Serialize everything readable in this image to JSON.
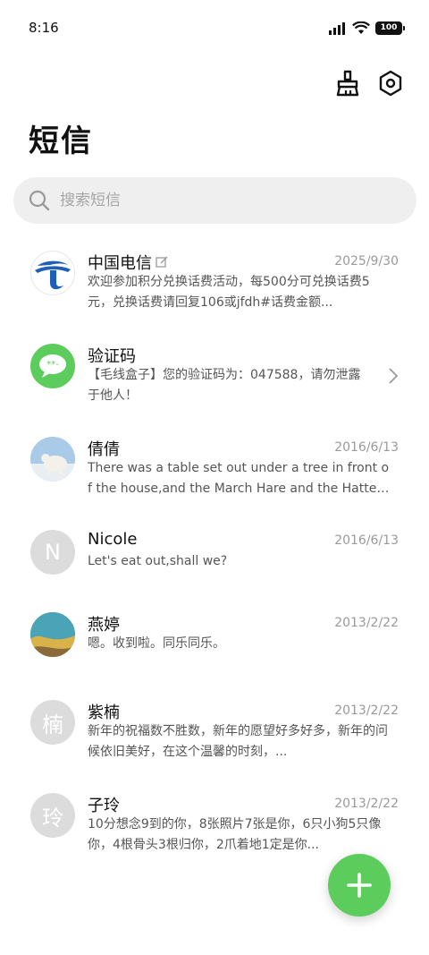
{
  "status": {
    "time": "8:16",
    "battery": "100"
  },
  "header": {
    "title": "短信"
  },
  "search": {
    "placeholder": "搜索短信"
  },
  "conversations": [
    {
      "name": "中国电信",
      "date": "2025/9/30",
      "preview": "欢迎参加积分兑换话费活动，每500分可兑换话费5元，兑换话费请回复106或jfdh#话费金额..."
    },
    {
      "name": "验证码",
      "date": "",
      "preview": "【毛线盒子】您的验证码为：047588，请勿泄露于他人！"
    },
    {
      "name": "倩倩",
      "date": "2016/6/13",
      "preview": "There was a table set out under a tree in front of the house,and the March Hare and the Hatter..."
    },
    {
      "name": "Nicole",
      "avatar_letter": "N",
      "date": "2016/6/13",
      "preview": "Let's eat out,shall we?"
    },
    {
      "name": "燕婷",
      "date": "2013/2/22",
      "preview": "嗯。收到啦。同乐同乐。"
    },
    {
      "name": "紫楠",
      "avatar_letter": "楠",
      "date": "2013/2/22",
      "preview": "新年的祝福数不胜数，新年的愿望好多好多，新年的问候依旧美好，在这个温馨的时刻，..."
    },
    {
      "name": "子玲",
      "avatar_letter": "玲",
      "date": "2013/2/22",
      "preview": "10分想念9到的你，8张照片7张是你，6只小狗5只像你，4根骨头3根归你，2爪着地1定是你..."
    }
  ],
  "colors": {
    "accent": "#5ccc5c",
    "telecom_blue": "#1f5fb8",
    "date_grey": "#9a9a9a"
  },
  "icons": {
    "clean": "broom-icon",
    "settings": "settings-hex-icon",
    "compose": "plus-icon"
  }
}
